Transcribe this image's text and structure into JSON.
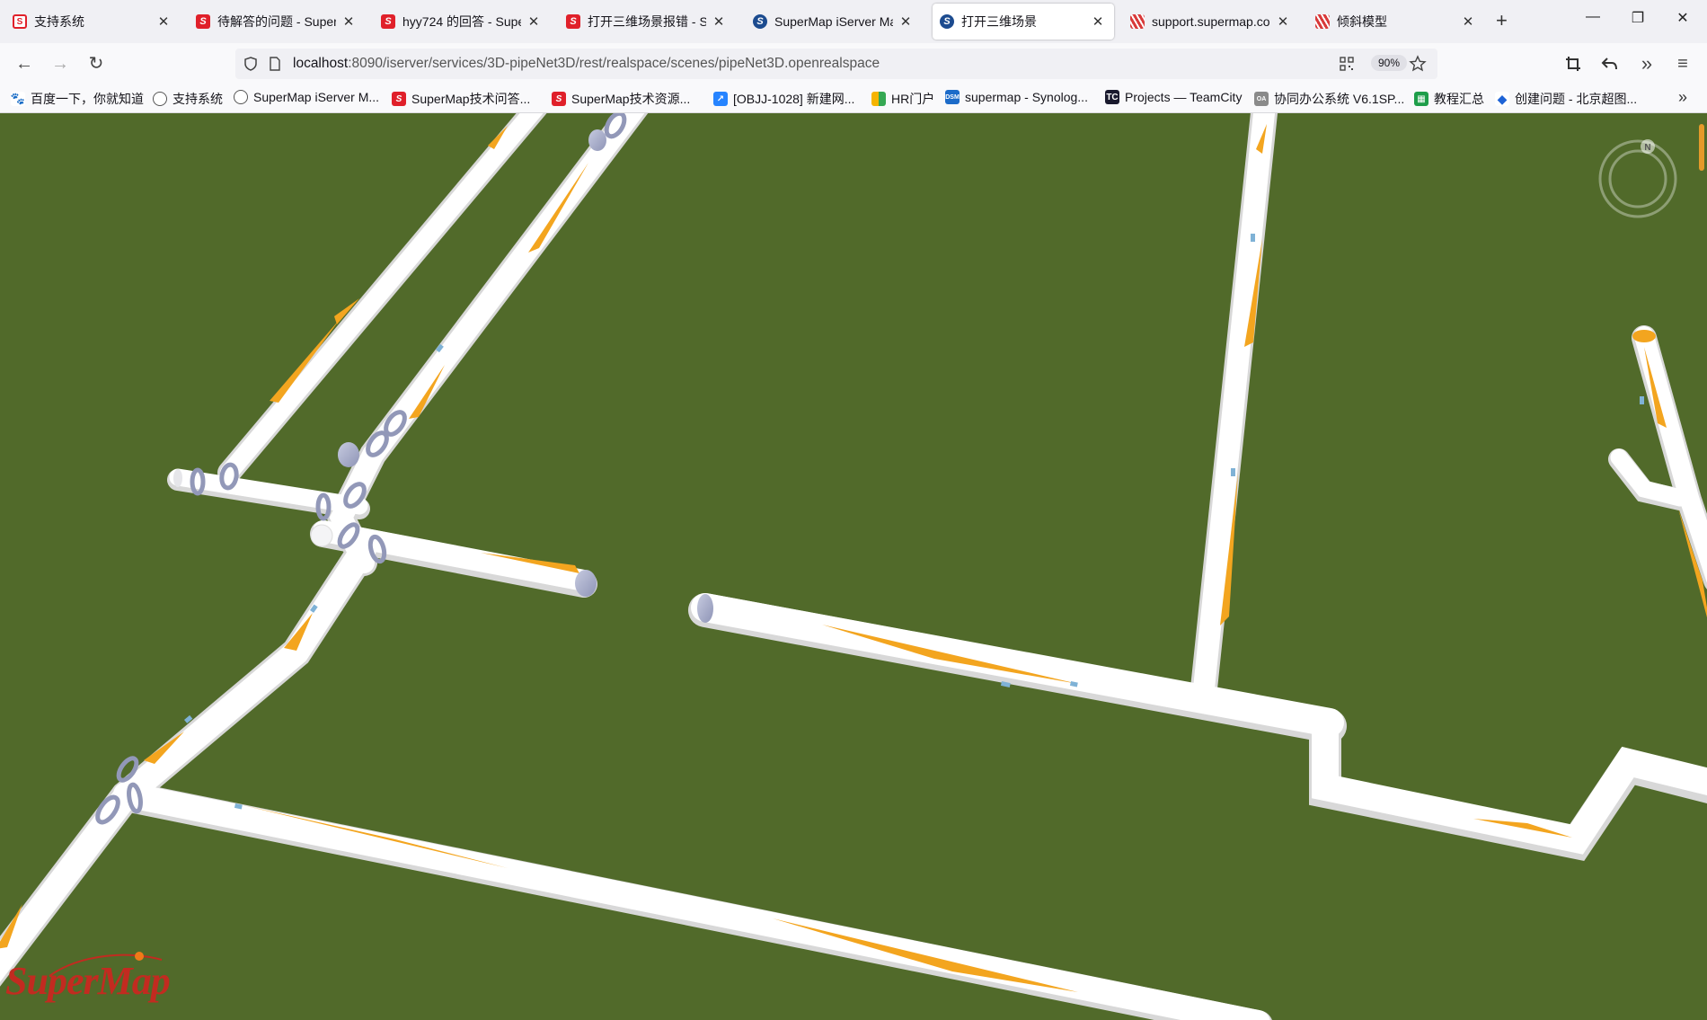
{
  "tabs": [
    {
      "title": "支持系统",
      "icon": "supermap-s-icon"
    },
    {
      "title": "待解答的问题 - SuperM",
      "icon": "supermap-s-icon"
    },
    {
      "title": "hyy724 的回答 - Super",
      "icon": "supermap-s-icon"
    },
    {
      "title": "打开三维场景报错 - Sup",
      "icon": "supermap-s-icon"
    },
    {
      "title": "SuperMap iServer Mar",
      "icon": "iserver-icon"
    },
    {
      "title": "打开三维场景",
      "icon": "iserver-icon",
      "active": true
    },
    {
      "title": "support.supermap.con",
      "icon": "stripes-icon"
    },
    {
      "title": "倾斜模型",
      "icon": "stripes-icon"
    }
  ],
  "nav": {
    "url_host": "localhost",
    "url_path": ":8090/iserver/services/3D-pipeNet3D/rest/realspace/scenes/pipeNet3D.openrealspace",
    "zoom": "90%"
  },
  "bookmarks": [
    {
      "label": "百度一下，你就知道",
      "icon": "baidu-paw-icon"
    },
    {
      "label": "支持系统",
      "icon": "globe-icon"
    },
    {
      "label": "SuperMap iServer M...",
      "icon": "globe-icon"
    },
    {
      "label": "SuperMap技术问答...",
      "icon": "supermap-s-icon"
    },
    {
      "label": "SuperMap技术资源...",
      "icon": "supermap-s-icon"
    },
    {
      "label": "[OBJJ-1028] 新建网...",
      "icon": "jira-icon"
    },
    {
      "label": "HR门户",
      "icon": "hr-icon"
    },
    {
      "label": "supermap - Synolog...",
      "icon": "dsm-icon"
    },
    {
      "label": "Projects — TeamCity",
      "icon": "teamcity-icon"
    },
    {
      "label": "协同办公系统 V6.1SP...",
      "icon": "office-icon"
    },
    {
      "label": "教程汇总",
      "icon": "sheet-icon"
    },
    {
      "label": "创建问题 - 北京超图...",
      "icon": "diamond-icon"
    }
  ],
  "scene": {
    "logo_text": "SuperMap",
    "compass_label": "N",
    "colors": {
      "ground": "#516a2a",
      "pipe": "#ffffff",
      "flow": "#f3a51f",
      "joint": "#9ea4c4"
    }
  }
}
